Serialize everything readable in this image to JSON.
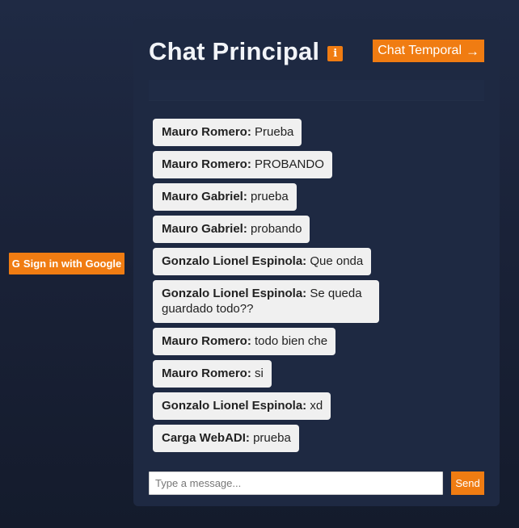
{
  "auth": {
    "signin_label": "Sign in with Google",
    "google_glyph": "G"
  },
  "chat": {
    "title": "Chat Principal",
    "info_glyph": "i",
    "temporal_button_label": "Chat Temporal",
    "arrow_glyph": "→",
    "messages": [
      {
        "author": "Mauro Romero:",
        "text": " Prueba"
      },
      {
        "author": "Mauro Romero:",
        "text": " PROBANDO"
      },
      {
        "author": "Mauro Gabriel:",
        "text": " prueba"
      },
      {
        "author": "Mauro Gabriel:",
        "text": " probando"
      },
      {
        "author": "Gonzalo Lionel Espinola:",
        "text": " Que onda"
      },
      {
        "author": "Gonzalo Lionel Espinola:",
        "text": " Se queda guardado todo??"
      },
      {
        "author": "Mauro Romero:",
        "text": " todo bien che"
      },
      {
        "author": "Mauro Romero:",
        "text": " si"
      },
      {
        "author": "Gonzalo Lionel Espinola:",
        "text": " xd"
      },
      {
        "author": "Carga WebADI:",
        "text": " prueba"
      }
    ],
    "input_placeholder": "Type a message...",
    "input_value": "",
    "send_label": "Send"
  },
  "colors": {
    "accent": "#f07c12",
    "panel": "#1e2942",
    "background": "#1a2238",
    "bubble": "#f0f0f0"
  },
  "icons": {
    "google": "google-icon",
    "info": "info-icon",
    "arrow": "arrow-right-icon"
  }
}
